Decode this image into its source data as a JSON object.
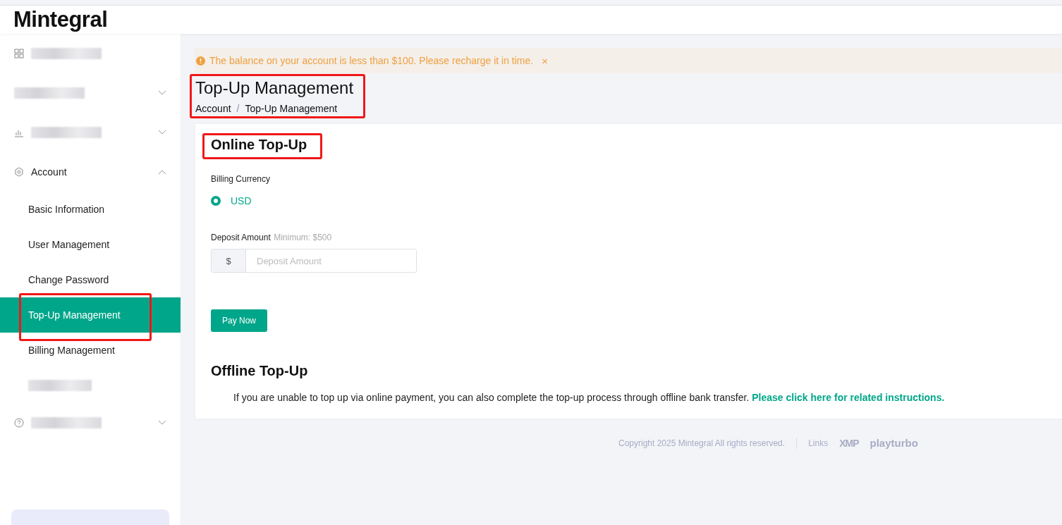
{
  "header": {
    "logo": "Mintegral"
  },
  "sidebar": {
    "items": [
      {
        "kind": "redacted-link"
      },
      {
        "kind": "redacted-menu"
      },
      {
        "kind": "redacted-menu"
      },
      {
        "kind": "group",
        "label": "Account",
        "expanded": true,
        "children": [
          {
            "kind": "link",
            "label": "Basic Information",
            "selected": false,
            "annotated": false
          },
          {
            "kind": "link",
            "label": "User Management",
            "selected": false,
            "annotated": false
          },
          {
            "kind": "link",
            "label": "Change Password",
            "selected": false,
            "annotated": false
          },
          {
            "kind": "link",
            "label": "Top-Up Management",
            "selected": true,
            "annotated": true
          },
          {
            "kind": "link",
            "label": "Billing Management",
            "selected": false,
            "annotated": false
          },
          {
            "kind": "redacted",
            "selected": false,
            "annotated": false
          }
        ]
      },
      {
        "kind": "redacted-menu"
      }
    ]
  },
  "alert": {
    "text": "The balance on your account is less than $100. Please recharge it in time.",
    "close": "×"
  },
  "page_header": {
    "title": "Top-Up Management",
    "annotated": true,
    "breadcrumb": [
      "Account",
      "Top-Up Management"
    ],
    "separator": "/"
  },
  "online": {
    "title": "Online Top-Up",
    "annotated": true,
    "currency_label": "Billing Currency",
    "currencies": [
      {
        "label": "USD",
        "selected": true
      }
    ],
    "amount_label": "Deposit Amount",
    "amount_hint": "Minimum: $500",
    "prefix": "$",
    "placeholder": "Deposit Amount",
    "button": "Pay Now"
  },
  "offline": {
    "title": "Offline Top-Up",
    "text": "If you are unable to top up via online payment, you can also complete the top-up process through offline bank transfer.",
    "link": "Please click here for related instructions."
  },
  "footer": {
    "copyright": "Copyright 2025 Mintegral All rights reserved.",
    "links_label": "Links",
    "logos": [
      "XMP",
      "playturbo"
    ]
  }
}
